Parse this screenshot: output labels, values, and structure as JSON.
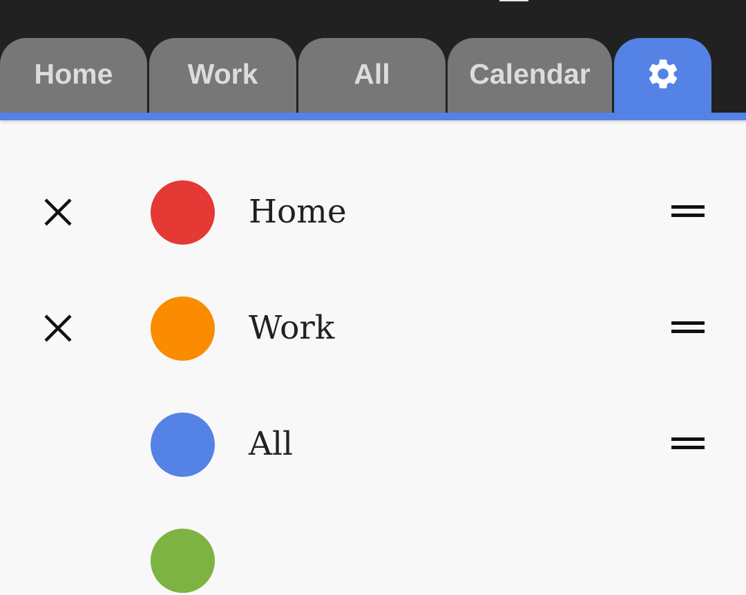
{
  "tabs": [
    {
      "label": "Home"
    },
    {
      "label": "Work"
    },
    {
      "label": "All"
    },
    {
      "label": "Calendar"
    }
  ],
  "settings_tab": {
    "icon": "gear-icon",
    "active": true
  },
  "colors": {
    "topbar": "#212121",
    "tab": "#777777",
    "tab_text": "#dcdcdc",
    "accent": "#5482e5",
    "background": "#f8f8f8"
  },
  "categories": [
    {
      "label": "Home",
      "color": "#e53935",
      "removable": true
    },
    {
      "label": "Work",
      "color": "#fb8c00",
      "removable": true
    },
    {
      "label": "All",
      "color": "#5482e5",
      "removable": false
    },
    {
      "color": "#7cb342",
      "removable": false
    }
  ]
}
